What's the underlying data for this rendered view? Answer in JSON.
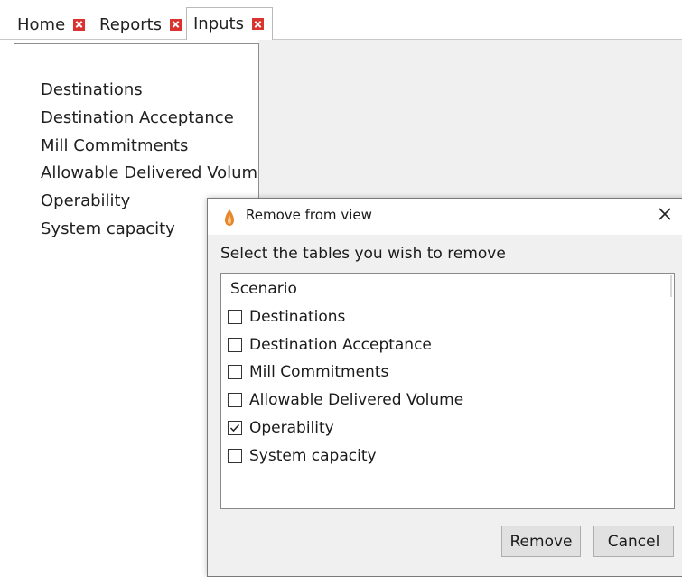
{
  "tabs": [
    {
      "label": "Home"
    },
    {
      "label": "Reports"
    },
    {
      "label": "Inputs",
      "active": true
    }
  ],
  "left_panel": {
    "items": [
      "Destinations",
      "Destination Acceptance",
      "Mill Commitments",
      "Allowable Delivered Volume",
      "Operability",
      "System capacity"
    ]
  },
  "dialog": {
    "title": "Remove from view",
    "instruction": "Select the tables you wish to remove",
    "list_header": "Scenario",
    "options": [
      {
        "label": "Destinations",
        "checked": false
      },
      {
        "label": "Destination Acceptance",
        "checked": false
      },
      {
        "label": "Mill Commitments",
        "checked": false
      },
      {
        "label": "Allowable Delivered Volume",
        "checked": false
      },
      {
        "label": "Operability",
        "checked": true
      },
      {
        "label": "System capacity",
        "checked": false
      }
    ],
    "remove_label": "Remove",
    "cancel_label": "Cancel"
  },
  "colors": {
    "tab_close": "#d9322f",
    "app_icon": "#e8862a",
    "dialog_bg": "#f0f0f0",
    "button_bg": "#e1e1e1"
  },
  "icons": {
    "tab_close": "close-icon",
    "app": "app-logo-icon",
    "dialog_close": "close-icon",
    "checked": "checkmark-icon"
  }
}
